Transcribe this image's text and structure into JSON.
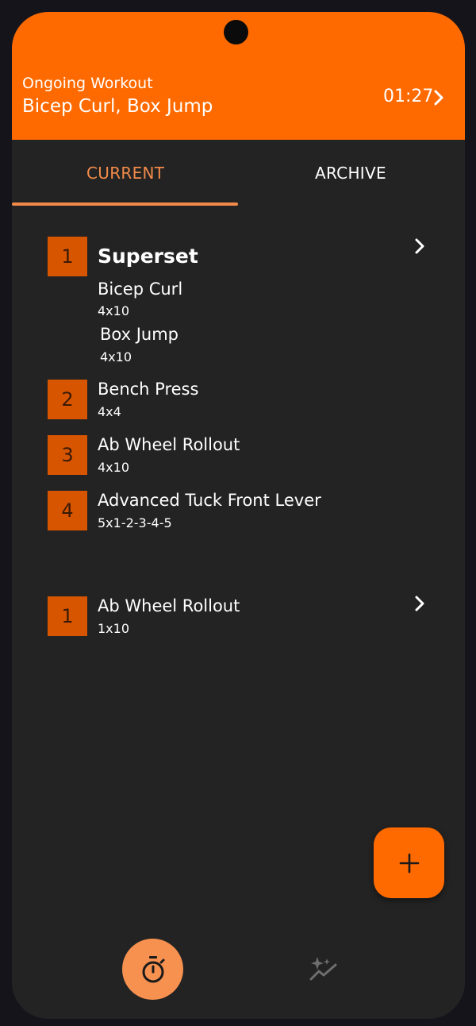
{
  "header": {
    "subtitle": "Ongoing Workout",
    "title": "Bicep Curl, Box Jump",
    "timer": "01:27"
  },
  "tabs": [
    {
      "label": "CURRENT",
      "active": true
    },
    {
      "label": "ARCHIVE",
      "active": false
    }
  ],
  "workouts": [
    {
      "items": [
        {
          "index": "1",
          "title": "Superset",
          "exercises": [
            {
              "name": "Bicep Curl",
              "sets": "4x10"
            },
            {
              "name": "Box Jump",
              "sets": "4x10"
            }
          ]
        },
        {
          "index": "2",
          "name": "Bench Press",
          "sets": "4x4"
        },
        {
          "index": "3",
          "name": "Ab Wheel Rollout",
          "sets": "4x10"
        },
        {
          "index": "4",
          "name": "Advanced Tuck Front Lever",
          "sets": "5x1-2-3-4-5"
        }
      ]
    },
    {
      "items": [
        {
          "index": "1",
          "name": "Ab Wheel Rollout",
          "sets": "1x10"
        }
      ]
    }
  ],
  "colors": {
    "accent": "#ff6a00",
    "accent_soft": "#f28b4a",
    "badge": "#d85500",
    "background": "#232323"
  },
  "icons": {
    "header": "chevron-right-icon",
    "row": "chevron-right-icon",
    "fab": "plus-icon",
    "nav_workout": "stopwatch-icon",
    "nav_stats": "sparkle-chart-icon"
  }
}
